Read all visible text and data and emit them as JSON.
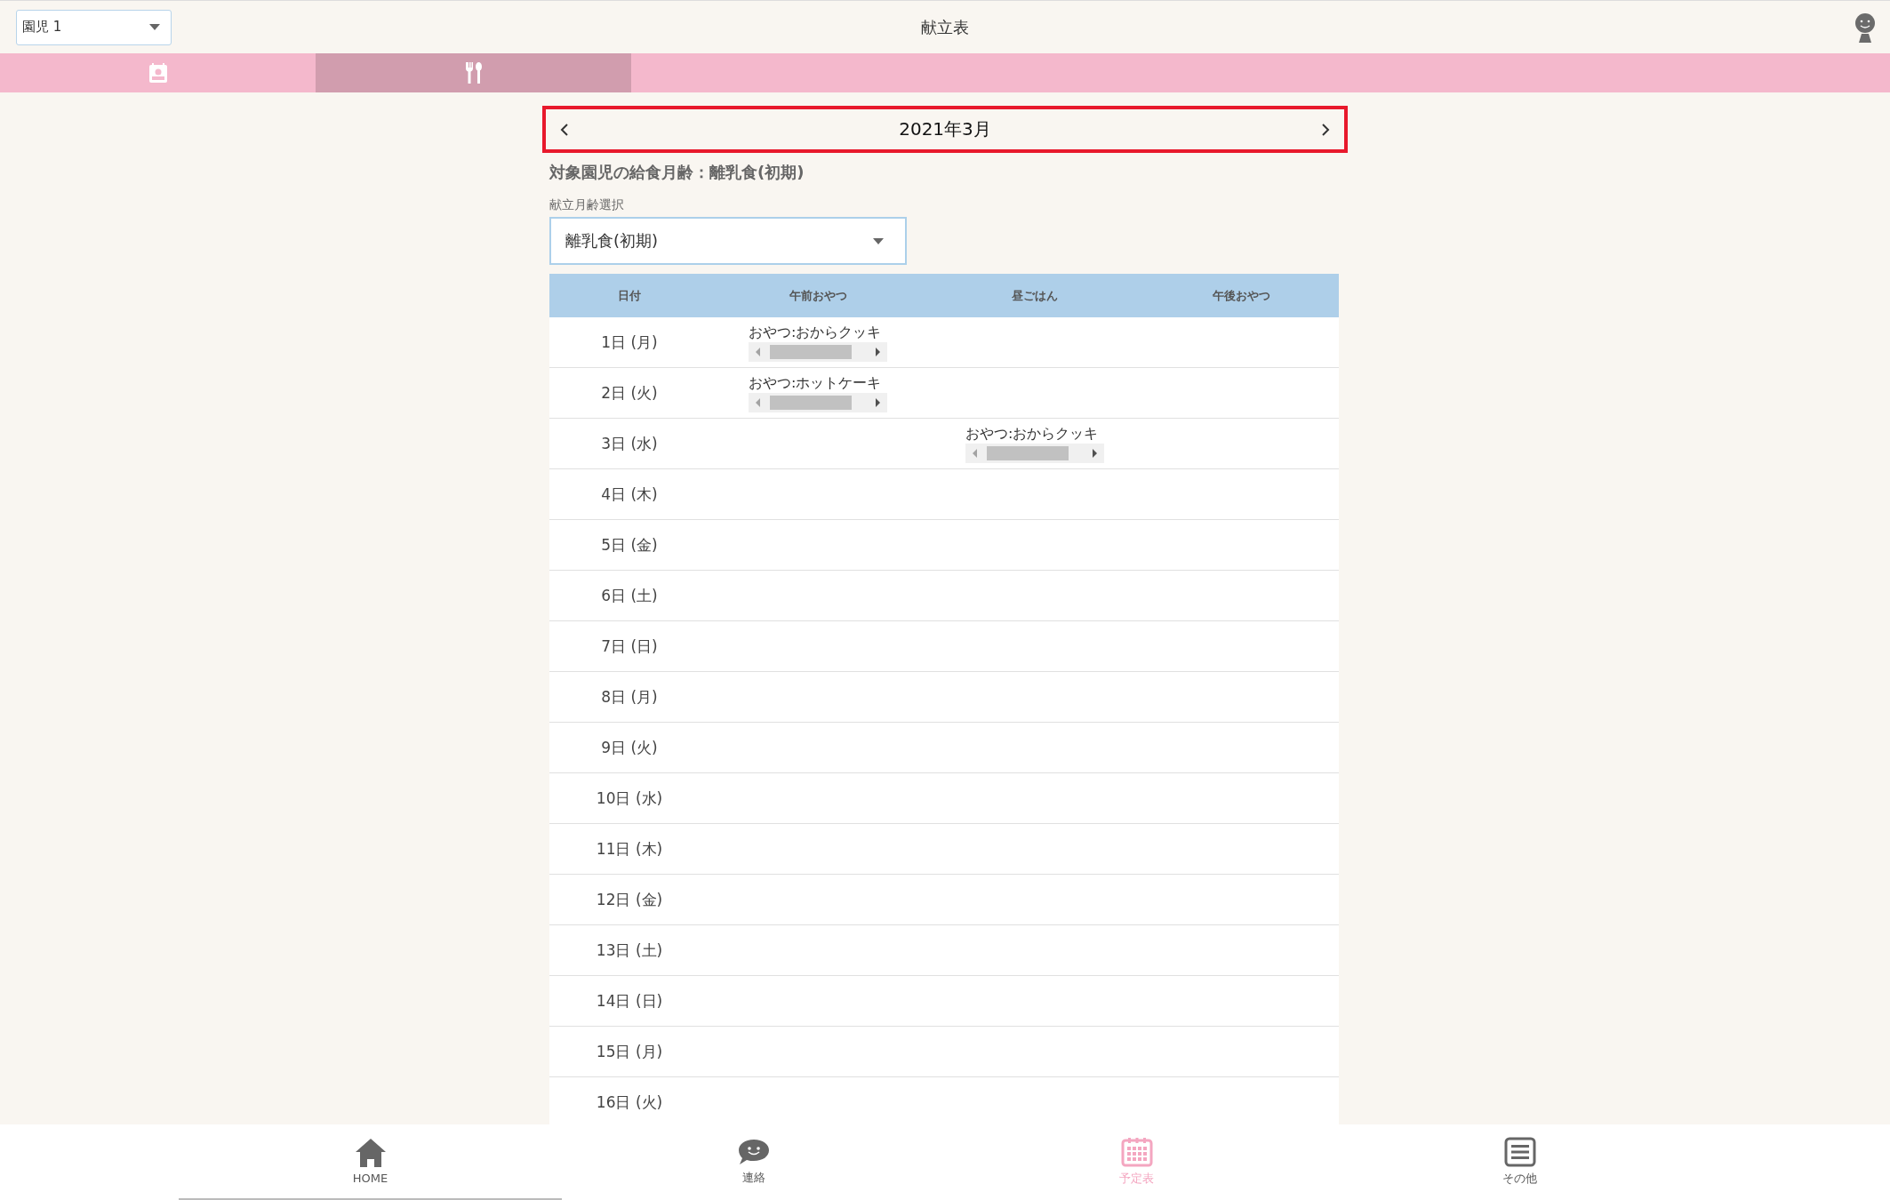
{
  "child_select": {
    "value": "園児 1"
  },
  "title": "献立表",
  "tabs": [
    {
      "kind": "calendar",
      "selected": false
    },
    {
      "kind": "meal",
      "selected": true
    }
  ],
  "month_nav": {
    "label": "2021年3月"
  },
  "age_info": "対象園児の給食月齢：離乳食(初期)",
  "age_select": {
    "label": "献立月齢選択",
    "value": "離乳食(初期)"
  },
  "table": {
    "columns": [
      "日付",
      "午前おやつ",
      "昼ごはん",
      "午後おやつ"
    ],
    "rows": [
      {
        "date": "1日 (月)",
        "morning_snack": "おやつ:おからクッキ"
      },
      {
        "date": "2日 (火)",
        "morning_snack": "おやつ:ホットケーキ"
      },
      {
        "date": "3日 (水)",
        "lunch": "おやつ:おからクッキ"
      },
      {
        "date": "4日 (木)"
      },
      {
        "date": "5日 (金)"
      },
      {
        "date": "6日 (土)"
      },
      {
        "date": "7日 (日)"
      },
      {
        "date": "8日 (月)"
      },
      {
        "date": "9日 (火)"
      },
      {
        "date": "10日 (水)"
      },
      {
        "date": "11日 (木)"
      },
      {
        "date": "12日 (金)"
      },
      {
        "date": "13日 (土)"
      },
      {
        "date": "14日 (日)"
      },
      {
        "date": "15日 (月)"
      },
      {
        "date": "16日 (火)"
      }
    ]
  },
  "bottom_nav": [
    {
      "kind": "home",
      "label": "HOME",
      "selected": true,
      "active": false
    },
    {
      "kind": "chat",
      "label": "連絡",
      "selected": false,
      "active": false
    },
    {
      "kind": "calendar",
      "label": "予定表",
      "selected": false,
      "active": true
    },
    {
      "kind": "menu",
      "label": "その他",
      "selected": false,
      "active": false
    }
  ]
}
